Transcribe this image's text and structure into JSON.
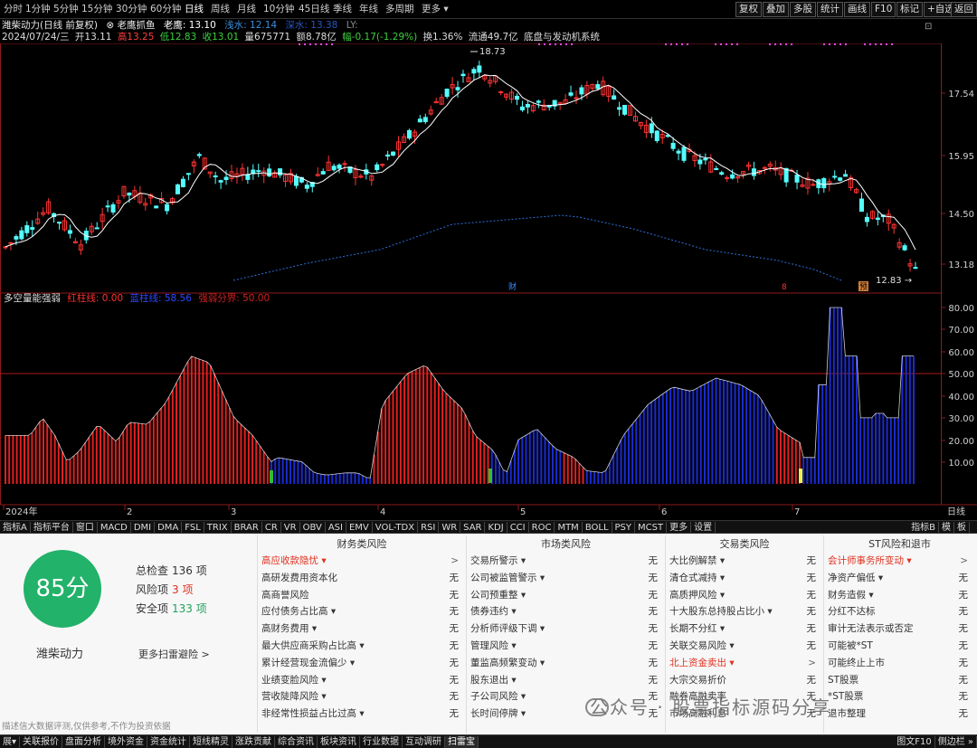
{
  "topbar": {
    "periods": [
      "分时",
      "1分钟",
      "5分钟",
      "15分钟",
      "30分钟",
      "60分钟",
      "日线",
      "周线",
      "月线",
      "10分钟",
      "45日线",
      "季线",
      "年线",
      "多周期",
      "更多 ▾"
    ],
    "active_period": "日线",
    "buttons": [
      "复权",
      "叠加",
      "多股",
      "统计",
      "画线",
      "F10",
      "标记",
      "+自选",
      "返回"
    ]
  },
  "info_line1": {
    "title": "潍柴动力(日线 前复权)",
    "indicator": "⊗ 老鹰抓鱼",
    "laoying_label": "老鹰: 13.10",
    "qianshui_label": "浅水: 12.14",
    "shenshui_label": "深水:",
    "extra_label": "深水: 13.38",
    "ly_label": "LY:"
  },
  "info_line2": {
    "date": "2024/07/24/三",
    "open": "开13.11",
    "high": "高13.25",
    "low": "低12.83",
    "close": "收13.01",
    "vol": "量675771",
    "amount": "额8.78亿",
    "change": "幅-0.17(-1.29%)",
    "turnover": "换1.36%",
    "float": "流通49.7亿",
    "system": "底盘与发动机系统"
  },
  "chart": {
    "price_ticks": [
      "17.54",
      "15.95",
      "14.50",
      "13.18"
    ],
    "high_label": "18.73",
    "low_label": "12.83",
    "marker_cai": "财",
    "marker_8": "8",
    "marker_jin": "预",
    "osc_ticks": [
      "80.00",
      "70.00",
      "60.00",
      "50.00",
      "40.00",
      "30.00",
      "20.00",
      "10.00"
    ],
    "date_labels": [
      "2024年",
      "2",
      "3",
      "4",
      "5",
      "6",
      "7"
    ],
    "axis_mode": "日线"
  },
  "indicator_title": {
    "name": "多空量能强弱",
    "red_line": "红柱线: 0.00",
    "blue_line": "蓝柱线: 58.56",
    "strong_line": "强弱分界: 50.00"
  },
  "indicator_tabs": [
    "指标A",
    "指标平台",
    "窗口",
    "MACD",
    "DMI",
    "DMA",
    "FSL",
    "TRIX",
    "BRAR",
    "CR",
    "VR",
    "OBV",
    "ASI",
    "EMV",
    "VOL-TDX",
    "RSI",
    "WR",
    "SAR",
    "KDJ",
    "CCI",
    "ROC",
    "MTM",
    "BOLL",
    "PSY",
    "MCST",
    "更多",
    "设置"
  ],
  "indicator_tabs_right": [
    "指标B",
    "模",
    "板"
  ],
  "risk": {
    "score": "85分",
    "stock_name": "潍柴动力",
    "total_label": "总检查",
    "total_value": "136 项",
    "risk_label": "风险项",
    "risk_value": "3 项",
    "safe_label": "安全项",
    "safe_value": "133 项",
    "more_scan": "更多扫雷避险 >",
    "disclaimer": "描述信大数据评测,仅供参考,不作为投资依据",
    "columns": [
      {
        "title": "财务类风险",
        "items": [
          {
            "label": "高应收款隐忧 ▾",
            "value": ">",
            "hl": true
          },
          {
            "label": "高研发费用资本化",
            "value": "无"
          },
          {
            "label": "高商誉风险",
            "value": "无"
          },
          {
            "label": "应付债务占比高 ▾",
            "value": "无"
          },
          {
            "label": "高财务费用 ▾",
            "value": "无"
          },
          {
            "label": "最大供应商采购占比高 ▾",
            "value": "无"
          },
          {
            "label": "累计经营现金流偏少 ▾",
            "value": "无"
          },
          {
            "label": "业绩变脸风险 ▾",
            "value": "无"
          },
          {
            "label": "营收陡降风险 ▾",
            "value": "无"
          },
          {
            "label": "非经常性损益占比过高 ▾",
            "value": "无"
          }
        ]
      },
      {
        "title": "市场类风险",
        "items": [
          {
            "label": "交易所警示 ▾",
            "value": "无"
          },
          {
            "label": "公司被监管警示 ▾",
            "value": "无"
          },
          {
            "label": "公司预重整 ▾",
            "value": "无"
          },
          {
            "label": "债券违约 ▾",
            "value": "无"
          },
          {
            "label": "分析师评级下调 ▾",
            "value": "无"
          },
          {
            "label": "管理风险 ▾",
            "value": "无"
          },
          {
            "label": "董监高频繁变动 ▾",
            "value": "无"
          },
          {
            "label": "股东退出 ▾",
            "value": "无"
          },
          {
            "label": "子公司风险 ▾",
            "value": "无"
          },
          {
            "label": "长时间停牌 ▾",
            "value": "无"
          }
        ]
      },
      {
        "title": "交易类风险",
        "items": [
          {
            "label": "大比例解禁 ▾",
            "value": "无"
          },
          {
            "label": "清仓式减持 ▾",
            "value": "无"
          },
          {
            "label": "高质押风险 ▾",
            "value": "无"
          },
          {
            "label": "十大股东总持股占比小 ▾",
            "value": "无"
          },
          {
            "label": "长期不分红 ▾",
            "value": "无"
          },
          {
            "label": "关联交易风险 ▾",
            "value": "无"
          },
          {
            "label": "北上资金卖出 ▾",
            "value": ">",
            "hl": true
          },
          {
            "label": "大宗交易折价",
            "value": "无"
          },
          {
            "label": "融券高融卖率",
            "value": "无"
          },
          {
            "label": "市场高融利息",
            "value": "无"
          }
        ]
      },
      {
        "title": "ST风险和退市",
        "items": [
          {
            "label": "会计师事务所变动 ▾",
            "value": ">",
            "hl": true
          },
          {
            "label": "净资产偏低 ▾",
            "value": "无"
          },
          {
            "label": "财务造假 ▾",
            "value": "无"
          },
          {
            "label": "分红不达标",
            "value": "无"
          },
          {
            "label": "审计无法表示或否定",
            "value": "无"
          },
          {
            "label": "可能被*ST",
            "value": "无"
          },
          {
            "label": "可能终止上市",
            "value": "无"
          },
          {
            "label": "ST股票",
            "value": "无"
          },
          {
            "label": "*ST股票",
            "value": "无"
          },
          {
            "label": "退市整理",
            "value": "无"
          }
        ]
      }
    ],
    "watermark": "公众号 · 股票指标源码分享"
  },
  "bottom_bar": [
    "展▾",
    "关联报价",
    "盘面分析",
    "境外资金",
    "资金统计",
    "短线精灵",
    "涨跌贡献",
    "综合资讯",
    "板块资讯",
    "行业数据",
    "互动调研",
    "扫雷宝"
  ],
  "bottom_bar_right": [
    "图文F10",
    "侧边栏 »"
  ]
}
